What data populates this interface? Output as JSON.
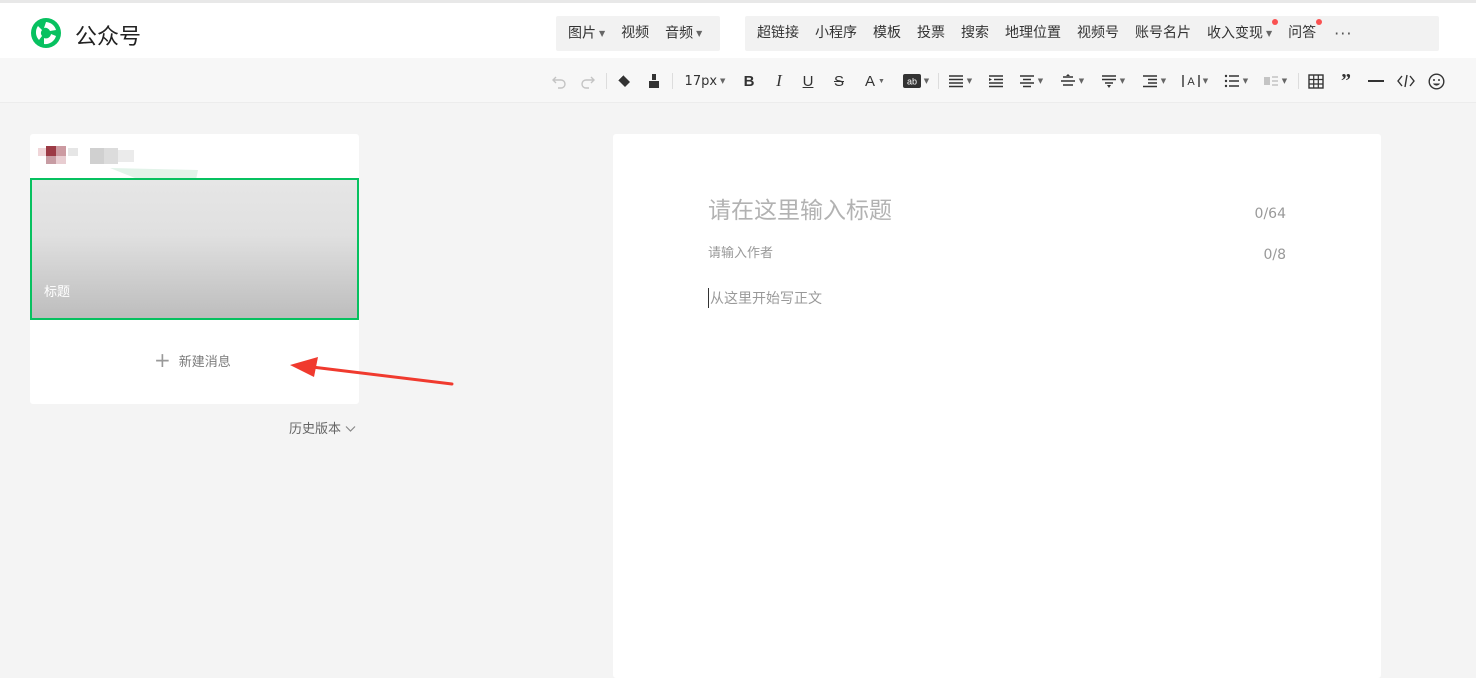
{
  "header": {
    "brand": "公众号",
    "insert_group1": [
      {
        "label": "图片",
        "dropdown": true
      },
      {
        "label": "视频",
        "dropdown": false
      },
      {
        "label": "音频",
        "dropdown": true
      }
    ],
    "insert_group2": [
      {
        "label": "超链接",
        "dropdown": false,
        "dot": false
      },
      {
        "label": "小程序",
        "dropdown": false,
        "dot": false
      },
      {
        "label": "模板",
        "dropdown": false,
        "dot": false
      },
      {
        "label": "投票",
        "dropdown": false,
        "dot": false
      },
      {
        "label": "搜索",
        "dropdown": false,
        "dot": false
      },
      {
        "label": "地理位置",
        "dropdown": false,
        "dot": false
      },
      {
        "label": "视频号",
        "dropdown": false,
        "dot": false
      },
      {
        "label": "账号名片",
        "dropdown": false,
        "dot": false
      },
      {
        "label": "收入变现",
        "dropdown": true,
        "dot": true
      },
      {
        "label": "问答",
        "dropdown": false,
        "dot": true
      }
    ],
    "more_label": "···"
  },
  "toolbar": {
    "font_size": "17px"
  },
  "left_panel": {
    "cover_title": "标题",
    "new_message": "新建消息",
    "history": "历史版本"
  },
  "editor": {
    "title_placeholder": "请在这里输入标题",
    "title_count": "0/64",
    "author_placeholder": "请输入作者",
    "author_count": "0/8",
    "body_placeholder": "从这里开始写正文"
  },
  "colors": {
    "brand_green": "#07c160",
    "notice_red": "#fa5151",
    "annotation_arrow": "#f03a2e"
  }
}
